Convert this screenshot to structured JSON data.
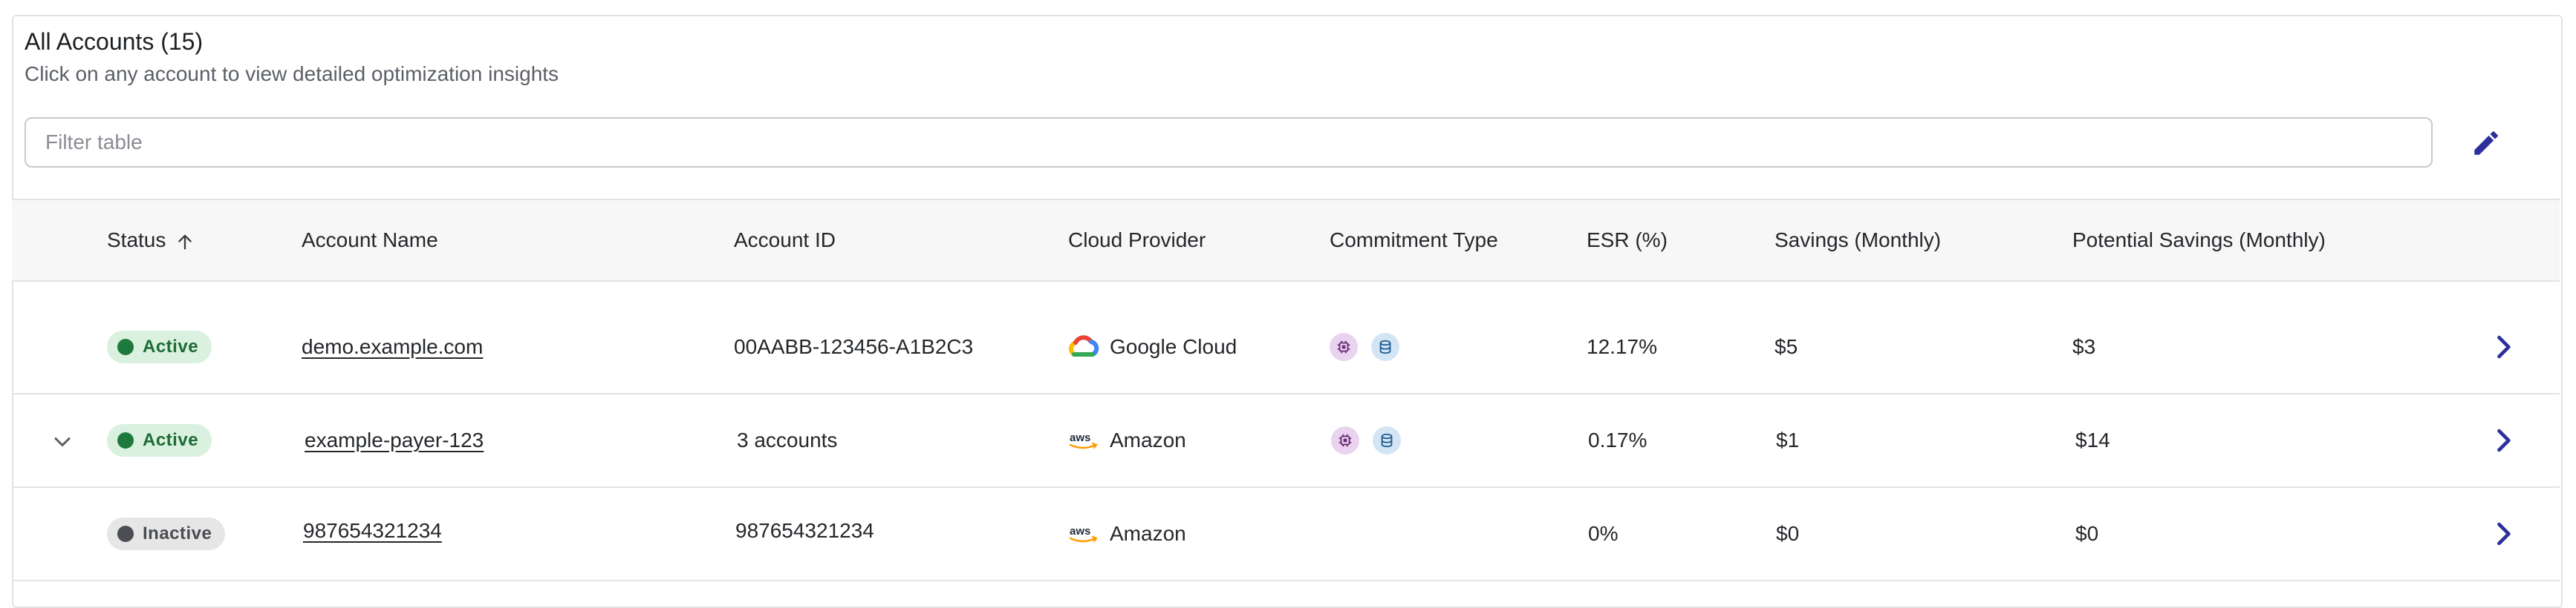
{
  "header": {
    "title": "All Accounts (15)",
    "subtitle": "Click on any account to view detailed optimization insights"
  },
  "filter": {
    "placeholder": "Filter table",
    "value": ""
  },
  "toolbar": {
    "edit_icon": "pencil-icon"
  },
  "columns": [
    "Status",
    "Account Name",
    "Account ID",
    "Cloud Provider",
    "Commitment Type",
    "ESR (%)",
    "Savings (Monthly)",
    "Potential Savings (Monthly)"
  ],
  "sort": {
    "column": "Status",
    "direction": "ascending",
    "icon": "arrow-up-icon"
  },
  "rows": [
    {
      "status": "Active",
      "account_name": "demo.example.com",
      "account_id": "00AABB-123456-A1B2C3",
      "provider": "Google Cloud",
      "provider_logo": "google-cloud-logo",
      "commitment_icons": [
        "compute-commitment-icon",
        "storage-commitment-icon"
      ],
      "esr": "12.17%",
      "savings": "$5",
      "potential_savings": "$3",
      "expandable": false
    },
    {
      "status": "Active",
      "account_name": "example-payer-123",
      "account_id": "3 accounts",
      "provider": "Amazon",
      "provider_logo": "aws-logo",
      "commitment_icons": [
        "compute-commitment-icon",
        "storage-commitment-icon"
      ],
      "esr": "0.17%",
      "savings": "$1",
      "potential_savings": "$14",
      "expandable": true
    },
    {
      "status": "Inactive",
      "account_name": "987654321234",
      "account_id": "987654321234",
      "provider": "Amazon",
      "provider_logo": "aws-logo",
      "commitment_icons": [],
      "esr": "0%",
      "savings": "$0",
      "potential_savings": "$0",
      "expandable": false
    }
  ],
  "colors": {
    "accent": "#2e2f9c",
    "active_badge_bg": "#d9f1de",
    "active_badge_text": "#1d6b35",
    "inactive_badge_bg": "#e6e6e6",
    "inactive_badge_text": "#4a4d52",
    "header_bg": "#f7f7f7",
    "border": "#e3e3e3"
  }
}
